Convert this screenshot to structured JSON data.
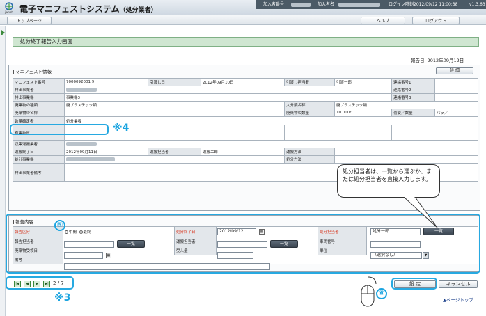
{
  "app": {
    "title": "電子マニフェストシステム",
    "subtitle": "（処分業者）",
    "subscriber_no_label": "加入者番号",
    "subscriber_name_label": "加入者名",
    "login_label": "ログイン時刻",
    "login_time": "2012/09/12 11:00:38",
    "version": "v1.3.63"
  },
  "nav": {
    "top_page": "トップページ",
    "help": "ヘルプ",
    "logout": "ログアウト"
  },
  "page": {
    "title": "処分終了報告入力画面",
    "report_date_label": "報告日",
    "report_date": "2012年09月12日"
  },
  "manifest": {
    "header": "マニフェスト情報",
    "detail_button": "詳 細",
    "manifest_no_label": "マニフェスト番号",
    "manifest_no": "7000092001 9",
    "delivery_date_label": "引渡し日",
    "delivery_date": "2012年09月10日",
    "delivery_person_label": "引渡し担当者",
    "delivery_person": "引渡一郎",
    "contact1_label": "連絡番号1",
    "contact2_label": "連絡番号2",
    "contact3_label": "連絡番号3",
    "discharger_label": "排出事業者",
    "site_label": "排出事業場",
    "site": "事業場3",
    "waste_type_label": "廃棄物の種類",
    "waste_type": "廃プラスチック類",
    "category_label": "大分類名称",
    "category": "廃プラスチック類",
    "waste_name_label": "廃棄物の名称",
    "quantity_label": "廃棄物の数量",
    "quantity": "10.000t",
    "packing_label": "荷姿／数量",
    "packing": "バラ／",
    "qty_confirmer_label": "数量確定者",
    "qty_confirmer": "処分業者",
    "hazard_label": "有害物質",
    "collector_label": "収集運搬業者",
    "transport_end_label": "運搬終了日",
    "transport_end": "2012年09月11日",
    "transporter_label": "運搬担当者",
    "transporter": "運搬二郎",
    "transport_method_label": "運搬方法",
    "disposal_site_label": "処分事業場",
    "disposal_method_label": "処分方法",
    "remarks_label": "排出事業者備考"
  },
  "report": {
    "header": "報告内容",
    "category_label": "報告区分",
    "radio_mid": "中間",
    "radio_final": "最終",
    "end_date_label": "処分終了日",
    "end_date": "2012/09/12",
    "person_label": "処分担当者",
    "person": "処分一郎",
    "list_button": "一覧",
    "reporter_label": "報告担当者",
    "driver_label": "運搬担当者",
    "vehicle_label": "車両番号",
    "received_date_label": "廃棄物受領日",
    "received_qty_label": "受入量",
    "unit_label": "単位",
    "unit": "（選択なし）",
    "note_label": "備考"
  },
  "pager": {
    "current": "2",
    "sep": "/",
    "total": "7"
  },
  "actions": {
    "set": "設 定",
    "cancel": "キャンセル",
    "to_top": "▲ページトップ"
  },
  "annotations": {
    "mark4": "※4",
    "mark3": "※3",
    "circle5": "⑤",
    "circle6": "⑥",
    "callout": "処分担当者は、一覧から選ぶか、または処分担当者を直接入力します。"
  },
  "colors": {
    "accent": "#27a9e1",
    "required": "#d8361f",
    "title_bg": "#cfe6d1"
  }
}
